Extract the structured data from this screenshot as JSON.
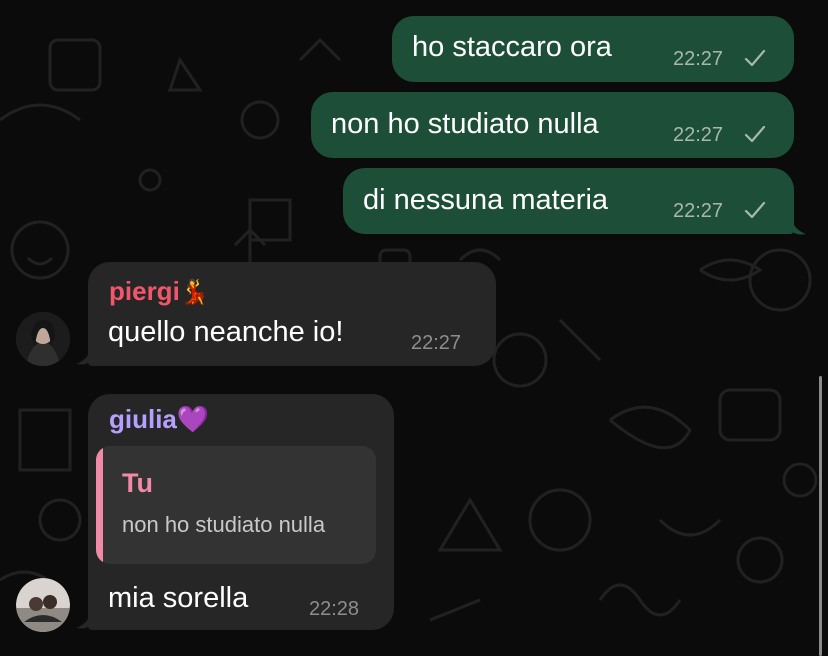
{
  "messages": [
    {
      "text": "ho staccaro ora",
      "time": "22:27",
      "direction": "outgoing",
      "status": "sent"
    },
    {
      "text": "non ho studiato nulla",
      "time": "22:27",
      "direction": "outgoing",
      "status": "sent"
    },
    {
      "text": "di nessuna materia",
      "time": "22:27",
      "direction": "outgoing",
      "status": "sent"
    },
    {
      "sender": "piergi",
      "sender_emoji": "💃",
      "sender_color": "#f2566a",
      "text": "quello neanche io!",
      "time": "22:27",
      "direction": "incoming"
    },
    {
      "sender": "giulia",
      "sender_emoji": "💜",
      "sender_color": "#b6a0ff",
      "text": "mia sorella",
      "time": "22:28",
      "direction": "incoming",
      "reply": {
        "title": "Tu",
        "text": "non ho studiato nulla"
      }
    }
  ],
  "colors": {
    "outgoing_bubble": "#1d4f38",
    "incoming_bubble": "#262626",
    "quote_accent": "#f08aa7"
  },
  "icons": [
    "check-icon",
    "avatar-piergi",
    "avatar-giulia"
  ]
}
